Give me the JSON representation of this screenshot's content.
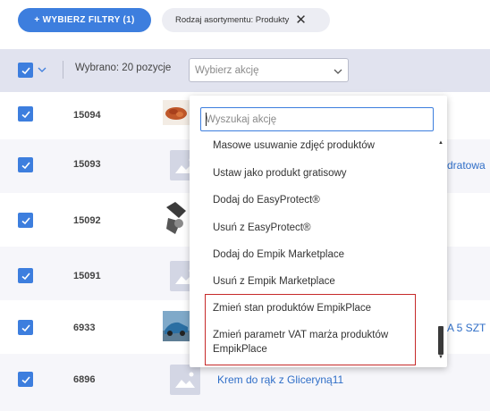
{
  "filters": {
    "button_label": "+ WYBIERZ FILTRY (1)",
    "chip_label": "Rodzaj asortymentu: Produkty"
  },
  "header": {
    "selected_text": "Wybrano: 20 pozycje",
    "action_placeholder": "Wybierz akcję"
  },
  "rows": [
    {
      "id": "15094",
      "name": ""
    },
    {
      "id": "15093",
      "name": "dratowa"
    },
    {
      "id": "15092",
      "name": ""
    },
    {
      "id": "15091",
      "name": ""
    },
    {
      "id": "6933",
      "name": "A 5 SZT"
    },
    {
      "id": "6896",
      "name": "Krem do rąk z Gliceryną11"
    }
  ],
  "dropdown": {
    "search_placeholder": "Wyszukaj akcję",
    "items": [
      "Masowe usuwanie zdjęć produktów",
      "Ustaw jako produkt gratisowy",
      "Dodaj do EasyProtect®",
      "Usuń z EasyProtect®",
      "Dodaj do Empik Marketplace",
      "Usuń z Empik Marketplace",
      "Zmień stan produktów EmpikPlace",
      "Zmień parametr VAT marża produktów EmpikPlace"
    ]
  },
  "colors": {
    "accent": "#3d7ede",
    "header_bg": "#e1e3ef",
    "highlight": "#c62a2a"
  }
}
